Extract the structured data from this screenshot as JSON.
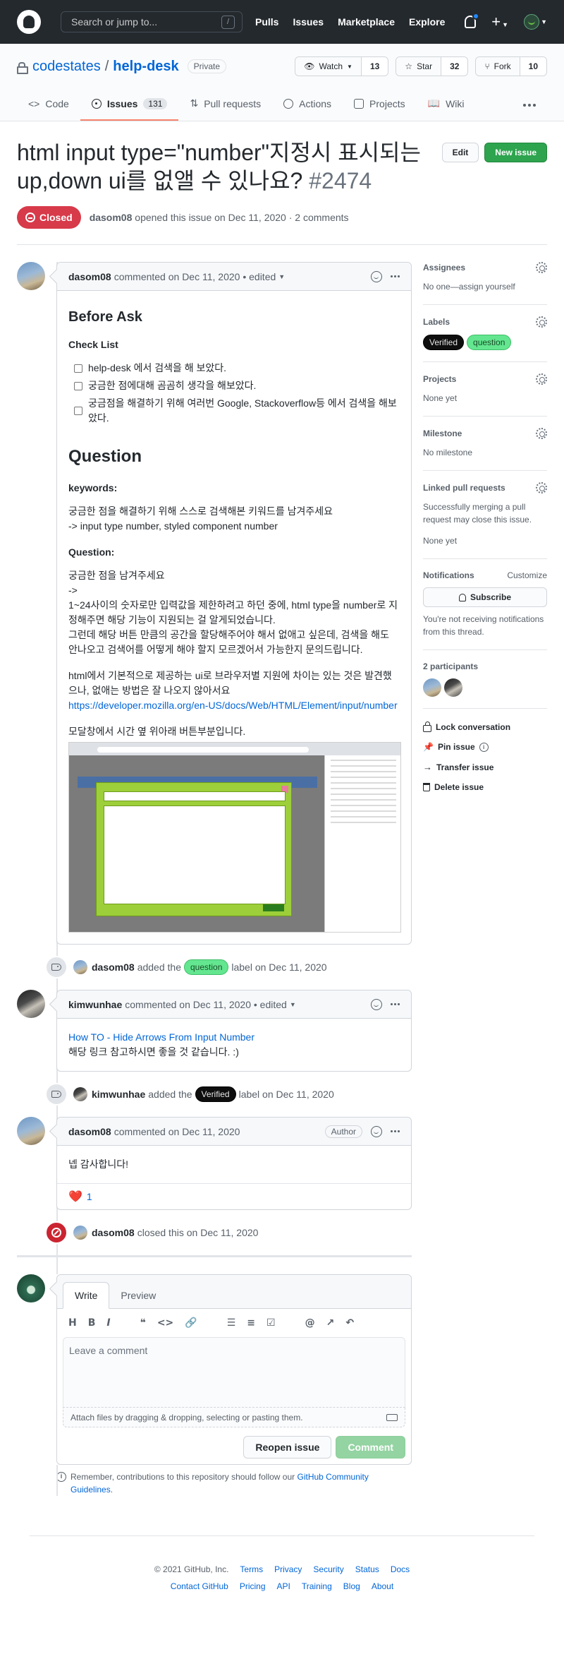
{
  "header": {
    "search_placeholder": "Search or jump to...",
    "slash": "/",
    "nav": [
      "Pulls",
      "Issues",
      "Marketplace",
      "Explore"
    ]
  },
  "repo": {
    "owner": "codestates",
    "sep": "/",
    "name": "help-desk",
    "visibility": "Private",
    "watch_label": "Watch",
    "watch_count": "13",
    "star_label": "Star",
    "star_count": "32",
    "fork_label": "Fork",
    "fork_count": "10",
    "tabs": [
      {
        "label": "Code"
      },
      {
        "label": "Issues",
        "count": "131"
      },
      {
        "label": "Pull requests"
      },
      {
        "label": "Actions"
      },
      {
        "label": "Projects"
      },
      {
        "label": "Wiki"
      }
    ]
  },
  "issue": {
    "title": "html input type=\"number\"지정시 표시되는 up,down ui를 없앨 수 있나요?",
    "number": "#2474",
    "edit_label": "Edit",
    "new_issue_label": "New issue",
    "state": "Closed",
    "author": "dasom08",
    "meta": "opened this issue on Dec 11, 2020 · 2 comments"
  },
  "comments": [
    {
      "author": "dasom08",
      "meta": "commented on Dec 11, 2020 • edited",
      "h_before": "Before Ask",
      "h_checklist": "Check List",
      "tasks": [
        "help-desk 에서 검색을 해 보았다.",
        "궁금한 점에대해 곰곰히 생각을 해보았다.",
        "궁금점을 해결하기 위해 여러번 Google, Stackoverflow등 에서 검색을 해보았다."
      ],
      "h_question": "Question",
      "h_keywords": "keywords:",
      "keywords_1": "궁금한 점을 해결하기 위해 스스로 검색해본 키워드를 남겨주세요",
      "keywords_2": "-> input type number, styled component number",
      "h_question2": "Question:",
      "q_1": "궁금한 점을 남겨주세요",
      "q_2": "->",
      "q_3": "1~24사이의 숫자로만 입력값을 제한하려고 하던 중에, html type을 number로 지정해주면 해당 기능이 지원되는 걸 알게되었습니다.",
      "q_4": "그런데 해당 버튼 만큼의 공간을 할당해주어야 해서 없애고 싶은데, 검색을 해도 안나오고 검색어를 어떻게 해야 할지 모르겠어서 가능한지 문의드립니다.",
      "q_5": "html에서 기본적으로 제공하는 ui로 브라우저별 지원에 차이는 있는 것은 발견했으나, 없애는 방법은 잘 나오지 않아서요",
      "link": "https://developer.mozilla.org/en-US/docs/Web/HTML/Element/input/number",
      "q_6": "모달창에서 시간 옆 위아래 버튼부분입니다."
    },
    {
      "author": "kimwunhae",
      "meta": "commented on Dec 11, 2020 • edited",
      "link": "How TO - Hide Arrows From Input Number",
      "text": "해당 링크 참고하시면 좋을 것 같습니다. :)"
    },
    {
      "author": "dasom08",
      "meta": "commented on Dec 11, 2020",
      "badge": "Author",
      "text": "넵 감사합니다!",
      "reaction": "❤️",
      "reaction_count": "1"
    }
  ],
  "events": [
    {
      "actor": "dasom08",
      "pre": "added the",
      "label": "question",
      "post": "label on Dec 11, 2020"
    },
    {
      "actor": "kimwunhae",
      "pre": "added the",
      "label": "Verified",
      "post": "label on Dec 11, 2020"
    },
    {
      "actor": "dasom08",
      "pre": "closed this",
      "post": "on Dec 11, 2020"
    }
  ],
  "form": {
    "tab_write": "Write",
    "tab_preview": "Preview",
    "placeholder": "Leave a comment",
    "attach": "Attach files by dragging & dropping, selecting or pasting them.",
    "reopen": "Reopen issue",
    "comment": "Comment",
    "protip_1": "Remember, contributions to this repository should follow our",
    "protip_link": "GitHub Community Guidelines",
    "protip_2": "."
  },
  "sidebar": {
    "assignees": "Assignees",
    "assignees_val": "No one—assign yourself",
    "labels": "Labels",
    "label_list": [
      "Verified",
      "question"
    ],
    "projects": "Projects",
    "projects_val": "None yet",
    "milestone": "Milestone",
    "milestone_val": "No milestone",
    "linked": "Linked pull requests",
    "linked_desc": "Successfully merging a pull request may close this issue.",
    "linked_val": "None yet",
    "notifications": "Notifications",
    "customize": "Customize",
    "subscribe": "Subscribe",
    "notif_desc": "You're not receiving notifications from this thread.",
    "participants": "2 participants",
    "actions": [
      "Lock conversation",
      "Pin issue",
      "Transfer issue",
      "Delete issue"
    ]
  },
  "footer": {
    "copyright": "© 2021 GitHub, Inc.",
    "row1": [
      "Terms",
      "Privacy",
      "Security",
      "Status",
      "Docs"
    ],
    "row2": [
      "Contact GitHub",
      "Pricing",
      "API",
      "Training",
      "Blog",
      "About"
    ]
  },
  "colors": {
    "closed": "#d73a49",
    "green": "#2ea44f",
    "link": "#0366d6",
    "label_question": "#63e68f",
    "label_verified": "#0e0e0e"
  }
}
